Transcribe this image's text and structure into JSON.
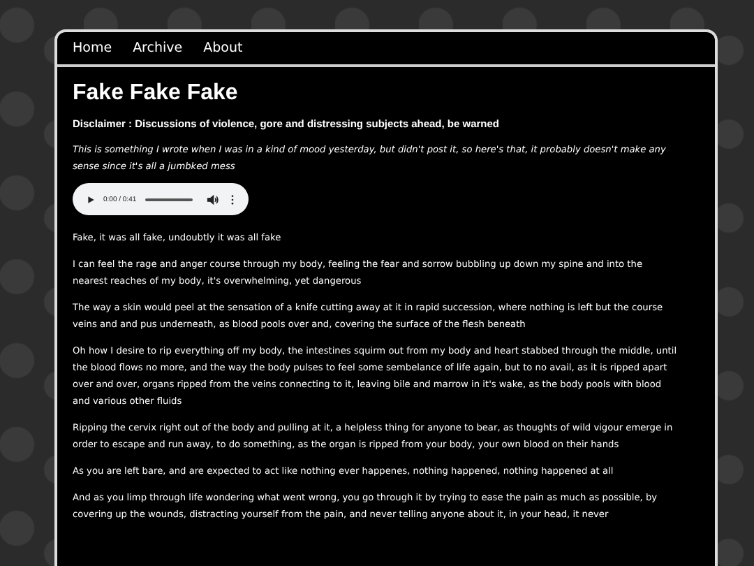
{
  "nav": {
    "items": [
      "Home",
      "Archive",
      "About"
    ]
  },
  "post": {
    "title": "Fake Fake Fake",
    "disclaimer": "Disclaimer : Discussions of violence, gore and distressing subjects ahead, be warned",
    "intro": "This is something I wrote when I was in a kind of mood yesterday, but didn't post it, so here's that, it probably doesn't make any sense since it's all a jumbked mess",
    "audio": {
      "time": "0:00 / 0:41"
    },
    "paragraphs": [
      "Fake, it was all fake, undoubtly it was all fake",
      "I can feel the rage and anger course through my body, feeling the fear and sorrow bubbling up down my spine and into the nearest reaches of my body, it's overwhelming, yet dangerous",
      "The way a skin would peel at the sensation of a knife cutting away at it in rapid succession, where nothing is left but the course veins and and pus underneath, as blood pools over and, covering the surface of the flesh beneath",
      "Oh how I desire to rip everything off my body, the intestines squirm out from my body and heart stabbed through the middle, until the blood flows no more, and the way the body pulses to feel some sembelance of life again, but to no avail, as it is ripped apart over and over, organs ripped from the veins connecting to it, leaving bile and marrow in it's wake, as the body pools with blood and various other fluids",
      "Ripping the cervix right out of the body and pulling at it, a helpless thing for anyone to bear, as thoughts of wild vigour emerge in order to escape and run away, to do something, as the organ is ripped from your body, your own blood on their hands",
      "As you are left bare, and are expected to act like nothing ever happenes, nothing happened, nothing happened at all",
      "And as you limp through life wondering what went wrong, you go through it by trying to ease the pain as much as possible, by covering up the wounds, distracting yourself from the pain, and never telling anyone about it, in your head, it never"
    ]
  }
}
